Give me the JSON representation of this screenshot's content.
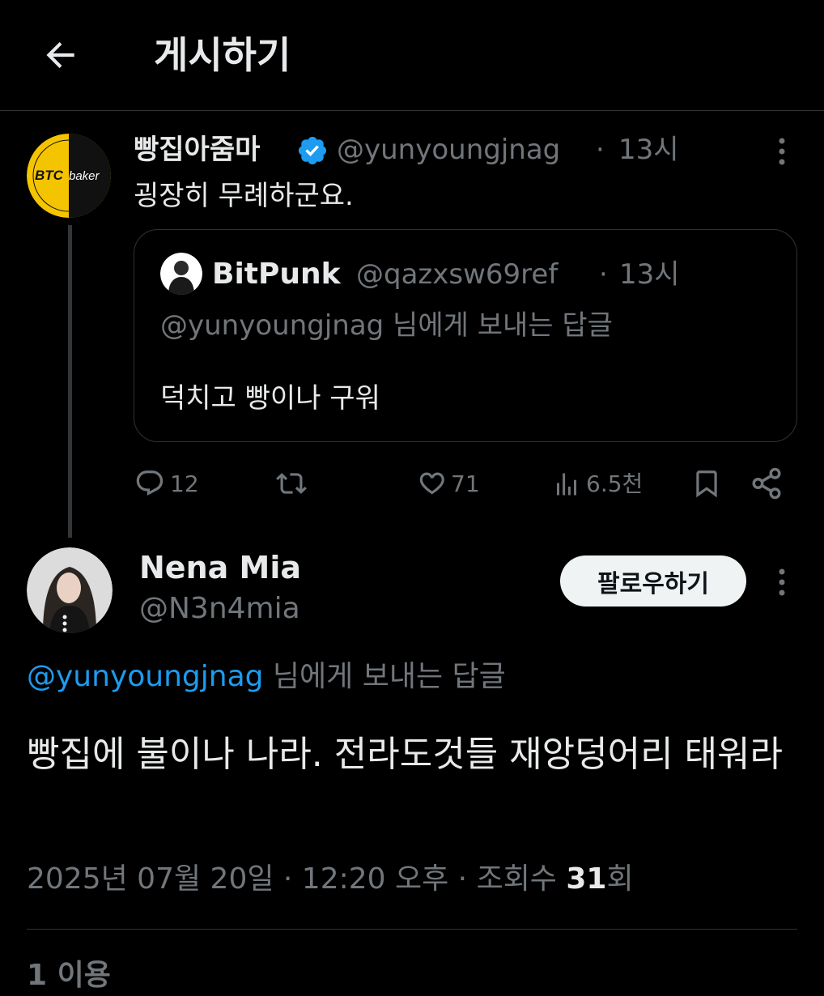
{
  "header": {
    "title": "게시하기"
  },
  "parent_tweet": {
    "avatar_text": "BTCbaker",
    "avatar_text_main": "BTC",
    "avatar_text_sub": "baker",
    "display_name": "빵집아줌마",
    "handle": "@yunyoungjnag",
    "separator": "·",
    "time": "13시",
    "text": "굉장히 무례하군요.",
    "quoted": {
      "display_name": "BitPunk",
      "handle": "@qazxsw69ref",
      "separator": "·",
      "time": "13시",
      "reply_line": "@yunyoungjnag 님에게 보내는 답글",
      "text": "덕치고 빵이나 구워"
    },
    "actions": {
      "replies": "12",
      "likes": "71",
      "views": "6.5천"
    }
  },
  "main_tweet": {
    "display_name": "Nena Mia",
    "handle": "@N3n4mia",
    "follow_label": "팔로우하기",
    "reply_to_handle": "@yunyoungjnag",
    "reply_to_suffix": " 님에게 보내는 답글",
    "text": "빵집에 불이나 나라. 전라도것들 재앙덩어리 태워라",
    "meta": {
      "datetime": "2025년 07월 20일 · 12:20 오후 · 조회수 ",
      "views": "31",
      "views_suffix": "회"
    }
  },
  "bottom_partial": "1 이용",
  "colors": {
    "background": "#000000",
    "text": "#e7e9ea",
    "muted": "#71767b",
    "link": "#1d9bf0",
    "verified": "#1d9bf0",
    "divider": "#2f3336",
    "avatar_yellow": "#f5c400"
  }
}
